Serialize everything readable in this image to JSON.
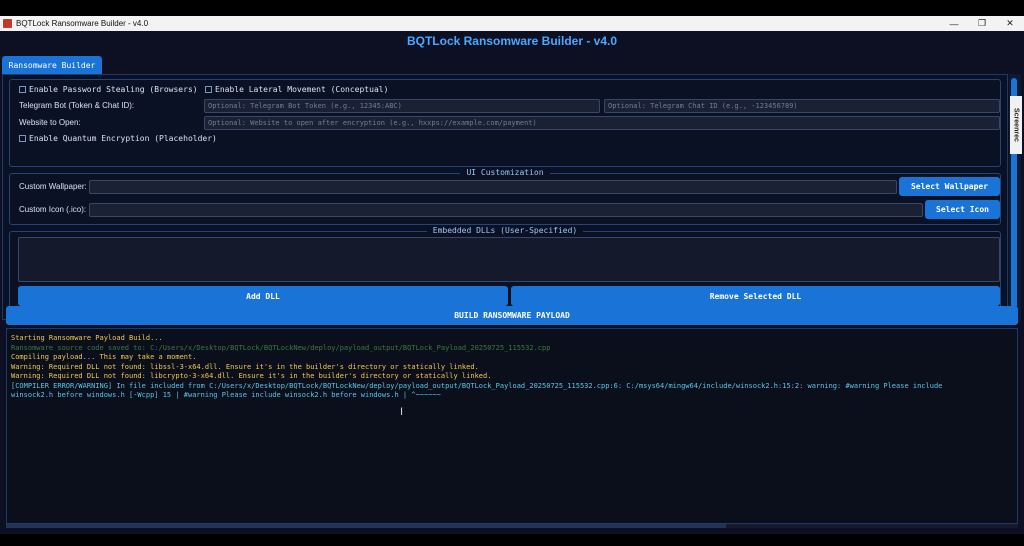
{
  "window": {
    "title": "BQTLock Ransomware Builder - v4.0",
    "controls": {
      "minimize": "—",
      "maximize": "❐",
      "close": "✕"
    }
  },
  "heading": "BQTLock Ransomware Builder -  v4.0",
  "tab": {
    "label": "Ransomware Builder"
  },
  "options": {
    "password_stealing": "Enable Password Stealing (Browsers)",
    "lateral_movement": "Enable Lateral Movement (Conceptual)",
    "telegram_label": "Telegram Bot (Token & Chat ID):",
    "telegram_token_placeholder": "Optional: Telegram Bot Token (e.g., 12345:ABC)",
    "telegram_chat_placeholder": "Optional: Telegram Chat ID (e.g., -123456789)",
    "website_label": "Website to Open:",
    "website_placeholder": "Optional: Website to open after encryption (e.g., hxxps://example.com/payment)",
    "quantum_encryption": "Enable Quantum Encryption (Placeholder)"
  },
  "ui_customization": {
    "title": "UI Customization",
    "wallpaper_label": "Custom Wallpaper:",
    "wallpaper_button": "Select Wallpaper",
    "icon_label": "Custom Icon (.ico):",
    "icon_button": "Select Icon"
  },
  "dlls": {
    "title": "Embedded DLLs (User-Specified)",
    "add_button": "Add DLL",
    "remove_button": "Remove Selected DLL"
  },
  "build_button": "BUILD RANSOMWARE PAYLOAD",
  "overlay_tag": "Screenrec",
  "console": {
    "lines": [
      "Starting Ransomware Payload Build...",
      "Ransomware source code saved to: C:/Users/x/Desktop/BQTLock/BQTLockNew/deploy/payload_output/BQTLock_Payload_20250725_115532.cpp",
      "Compiling payload... This may take a moment.",
      "Warning: Required DLL not found: libssl-3-x64.dll. Ensure it's in the builder's directory or statically linked.",
      "Warning: Required DLL not found: libcrypto-3-x64.dll. Ensure it's in the builder's directory or statically linked.",
      "[COMPILER ERROR/WARNING] In file included from C:/Users/x/Desktop/BQTLock/BQTLockNew/deploy/payload_output/BQTLock_Payload_20250725_115532.cpp:6: C:/msys64/mingw64/include/winsock2.h:15:2: warning: #warning Please include",
      "winsock2.h before windows.h [-Wcpp] 15 | #warning Please include winsock2.h before windows.h | ^~~~~~~"
    ]
  },
  "colors": {
    "accent": "#1a74d8",
    "heading": "#4aa8ff",
    "background": "#0c1022",
    "console_yellow": "#f2c94c",
    "console_green": "#3a7a40",
    "console_cyan": "#56c8e8"
  },
  "icons": {
    "app": "app-icon",
    "text_cursor": "text-cursor-icon"
  }
}
